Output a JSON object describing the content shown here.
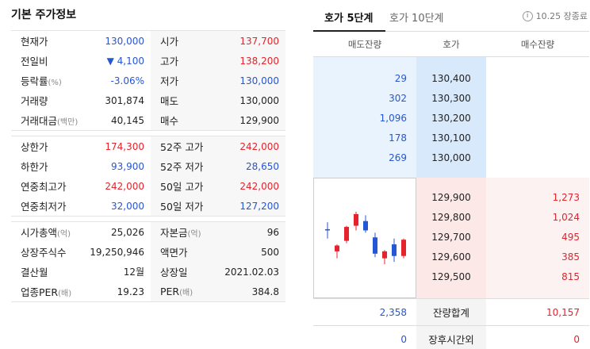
{
  "basic_info": {
    "title": "기본 주가정보",
    "sections": [
      {
        "left": [
          {
            "label": "현재가",
            "value": "130,000",
            "color": "blue"
          },
          {
            "label": "전일비",
            "value": "▼ 4,100",
            "color": "blue"
          },
          {
            "label": "등락률",
            "sub": "(%)",
            "value": "-3.06%",
            "color": "blue"
          },
          {
            "label": "거래량",
            "value": "301,874",
            "color": "black"
          },
          {
            "label": "거래대금",
            "sub": "(백만)",
            "value": "40,145",
            "color": "black"
          }
        ],
        "right": [
          {
            "label": "시가",
            "value": "137,700",
            "color": "red"
          },
          {
            "label": "고가",
            "value": "138,200",
            "color": "red"
          },
          {
            "label": "저가",
            "value": "130,000",
            "color": "blue"
          },
          {
            "label": "매도",
            "value": "130,000",
            "color": "black"
          },
          {
            "label": "매수",
            "value": "129,900",
            "color": "black"
          }
        ]
      },
      {
        "left": [
          {
            "label": "상한가",
            "value": "174,300",
            "color": "red"
          },
          {
            "label": "하한가",
            "value": "93,900",
            "color": "blue"
          },
          {
            "label": "연중최고가",
            "value": "242,000",
            "color": "red"
          },
          {
            "label": "연중최저가",
            "value": "32,000",
            "color": "blue"
          }
        ],
        "right": [
          {
            "label": "52주 고가",
            "value": "242,000",
            "color": "red"
          },
          {
            "label": "52주 저가",
            "value": "28,650",
            "color": "blue"
          },
          {
            "label": "50일 고가",
            "value": "242,000",
            "color": "red"
          },
          {
            "label": "50일 저가",
            "value": "127,200",
            "color": "blue"
          }
        ]
      },
      {
        "left": [
          {
            "label": "시가총액",
            "sub": "(억)",
            "value": "25,026",
            "color": "black"
          },
          {
            "label": "상장주식수",
            "value": "19,250,946",
            "color": "black"
          },
          {
            "label": "결산월",
            "value": "12월",
            "color": "black"
          },
          {
            "label": "업종PER",
            "sub": "(배)",
            "value": "19.23",
            "color": "black"
          }
        ],
        "right": [
          {
            "label": "자본금",
            "sub": "(억)",
            "value": "96",
            "color": "black"
          },
          {
            "label": "액면가",
            "value": "500",
            "color": "black"
          },
          {
            "label": "상장일",
            "value": "2021.02.03",
            "color": "black"
          },
          {
            "label": "PER",
            "sub": "(배)",
            "value": "384.8",
            "color": "black"
          }
        ]
      }
    ]
  },
  "orderbook": {
    "tabs": [
      "호가 5단계",
      "호가 10단계"
    ],
    "market_status": "10.25 장종료",
    "headers": [
      "매도잔량",
      "호가",
      "매수잔량"
    ],
    "asks": [
      {
        "qty": "29",
        "price": "130,400"
      },
      {
        "qty": "302",
        "price": "130,300"
      },
      {
        "qty": "1,096",
        "price": "130,200"
      },
      {
        "qty": "178",
        "price": "130,100"
      },
      {
        "qty": "269",
        "price": "130,000"
      }
    ],
    "bids": [
      {
        "price": "129,900",
        "qty": "1,273"
      },
      {
        "price": "129,800",
        "qty": "1,024"
      },
      {
        "price": "129,700",
        "qty": "495"
      },
      {
        "price": "129,600",
        "qty": "385"
      },
      {
        "price": "129,500",
        "qty": "815"
      }
    ],
    "total": {
      "ask": "2,358",
      "label": "잔량합계",
      "bid": "10,157"
    },
    "after_hours": {
      "ask": "0",
      "label": "장후시간외",
      "bid": "0"
    }
  },
  "mini_chart": {
    "up_color": "#e4232c",
    "down_color": "#2456d6",
    "candles": [
      {
        "o": 133200,
        "h": 134400,
        "l": 131600,
        "c": 133000
      },
      {
        "o": 129400,
        "h": 130600,
        "l": 128200,
        "c": 130400
      },
      {
        "o": 131200,
        "h": 133800,
        "l": 130800,
        "c": 133600
      },
      {
        "o": 133800,
        "h": 136200,
        "l": 133000,
        "c": 135800
      },
      {
        "o": 134600,
        "h": 135600,
        "l": 132600,
        "c": 133000
      },
      {
        "o": 131800,
        "h": 132600,
        "l": 128400,
        "c": 129000
      },
      {
        "o": 128200,
        "h": 129600,
        "l": 127200,
        "c": 129400
      },
      {
        "o": 130600,
        "h": 131600,
        "l": 127600,
        "c": 128600
      },
      {
        "o": 128600,
        "h": 131600,
        "l": 128200,
        "c": 131400
      }
    ]
  }
}
